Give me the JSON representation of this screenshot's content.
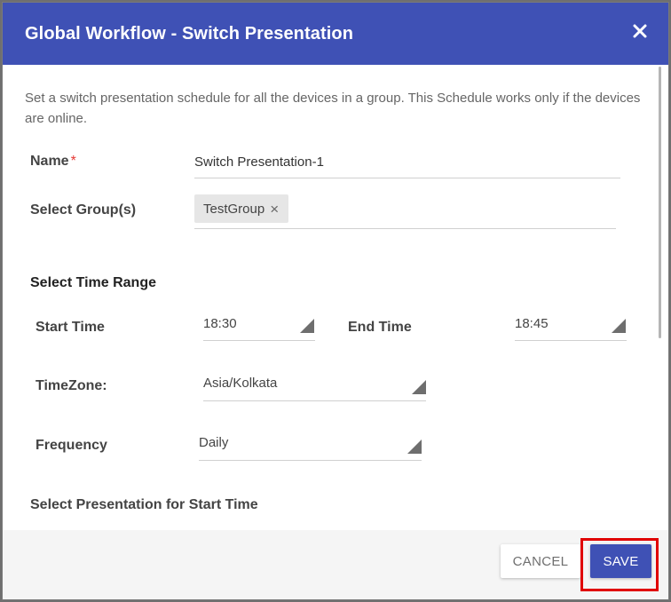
{
  "dialog": {
    "title": "Global Workflow - Switch Presentation",
    "close_icon": "close-icon",
    "description": "Set a switch presentation schedule for all the devices in a group. This Schedule works only if the devices are online."
  },
  "form": {
    "name_label": "Name",
    "required_marker": "*",
    "name_value": "Switch Presentation-1",
    "groups_label": "Select Group(s)",
    "selected_group": "TestGroup",
    "chip_remove_glyph": "×",
    "time_range_heading": "Select Time Range",
    "start_time_label": "Start Time",
    "start_time_value": "18:30",
    "end_time_label": "End Time",
    "end_time_value": "18:45",
    "timezone_label": "TimeZone:",
    "timezone_value": "Asia/Kolkata",
    "frequency_label": "Frequency",
    "frequency_value": "Daily",
    "presentation_heading": "Select Presentation for Start Time"
  },
  "footer": {
    "cancel_label": "CANCEL",
    "save_label": "SAVE"
  },
  "colors": {
    "header": "#3f51b5",
    "save_button": "#3f51b5",
    "highlight": "#e00000",
    "required": "#e53935"
  }
}
